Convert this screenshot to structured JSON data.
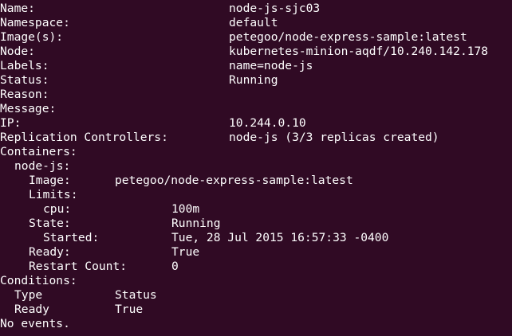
{
  "theme": {
    "background": "#300a24",
    "foreground": "#ffffff"
  },
  "output": {
    "name_label": "Name:",
    "name_value": "node-js-sjc03",
    "namespace_label": "Namespace:",
    "namespace_value": "default",
    "images_label": "Image(s):",
    "images_value": "petegoo/node-express-sample:latest",
    "node_label": "Node:",
    "node_value": "kubernetes-minion-aqdf/10.240.142.178",
    "labels_label": "Labels:",
    "labels_value": "name=node-js",
    "status_label": "Status:",
    "status_value": "Running",
    "reason_label": "Reason:",
    "message_label": "Message:",
    "ip_label": "IP:",
    "ip_value": "10.244.0.10",
    "rc_label": "Replication Controllers:",
    "rc_value": "node-js (3/3 replicas created)",
    "containers_label": "Containers:",
    "container": {
      "name_label": "node-js:",
      "image_label": "Image:",
      "image_value": "petegoo/node-express-sample:latest",
      "limits_label": "Limits:",
      "cpu_label": "cpu:",
      "cpu_value": "100m",
      "state_label": "State:",
      "state_value": "Running",
      "started_label": "Started:",
      "started_value": "Tue, 28 Jul 2015 16:57:33 -0400",
      "ready_label": "Ready:",
      "ready_value": "True",
      "restart_label": "Restart Count:",
      "restart_value": "0"
    },
    "conditions_label": "Conditions:",
    "conditions": {
      "header_type": "Type",
      "header_status": "Status",
      "row_type": "Ready",
      "row_status": "True"
    },
    "events_text": "No events."
  }
}
